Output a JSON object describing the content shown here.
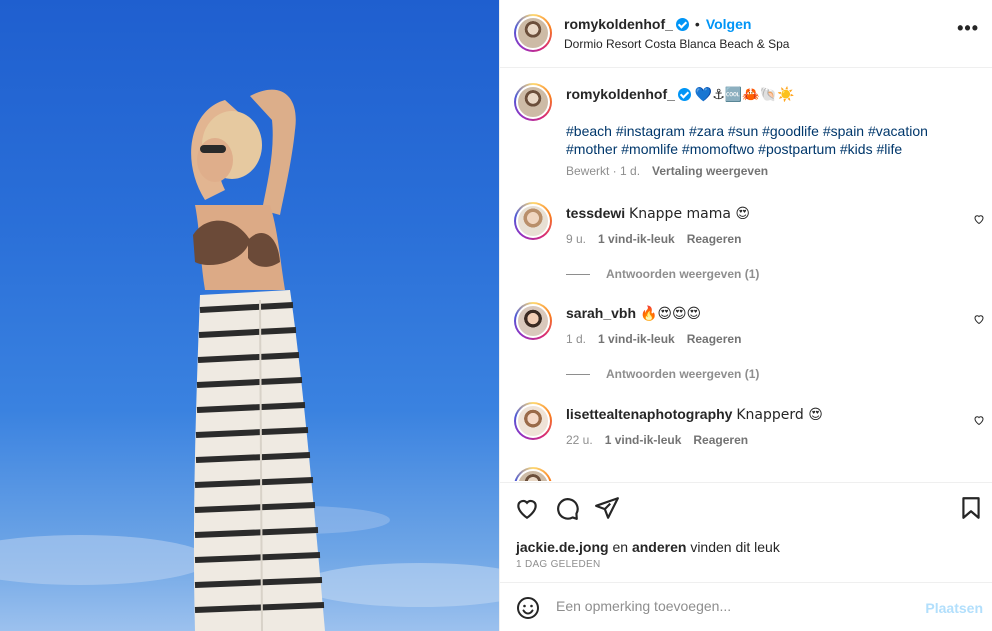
{
  "post": {
    "username": "romykoldenhof_",
    "follow_label": "Volgen",
    "separator": "•",
    "location": "Dormio Resort Costa Blanca Beach & Spa",
    "more_label": "•••"
  },
  "caption": {
    "username": "romykoldenhof_",
    "emojis": "💙⚓🆒🦀🐚☀️",
    "hashtags_line1": "#beach #instagram #zara #sun #goodlife #spain #vacation",
    "hashtags_line2": "#mother #momlife #momoftwo #postpartum #kids #life",
    "edited": "Bewerkt · 1 d.",
    "translate": "Vertaling weergeven"
  },
  "comments": [
    {
      "username": "tessdewi",
      "text": "Knappe mama 😍",
      "time": "9 u.",
      "likes": "1 vind-ik-leuk",
      "reply": "Reageren",
      "replies": "Antwoorden weergeven (1)"
    },
    {
      "username": "sarah_vbh",
      "text": "🔥😍😍😍",
      "time": "1 d.",
      "likes": "1 vind-ik-leuk",
      "reply": "Reageren",
      "replies": "Antwoorden weergeven (1)"
    },
    {
      "username": "lisettealtenaphotography",
      "text": "Knapperd 😍",
      "time": "22 u.",
      "likes": "1 vind-ik-leuk",
      "reply": "Reageren"
    }
  ],
  "likes_line": {
    "user": "jackie.de.jong",
    "connector": "en",
    "others": "anderen",
    "suffix": "vinden dit leuk"
  },
  "date": "1 DAG GELEDEN",
  "comment_box": {
    "placeholder": "Een opmerking toevoegen...",
    "post_label": "Plaatsen"
  },
  "icons": [
    "heart-icon",
    "comment-icon",
    "share-icon",
    "bookmark-icon",
    "emoji-icon",
    "verified-icon"
  ],
  "colors": {
    "accent": "#0095f6",
    "hashtag": "#00376b",
    "muted": "#8e8e8e"
  }
}
